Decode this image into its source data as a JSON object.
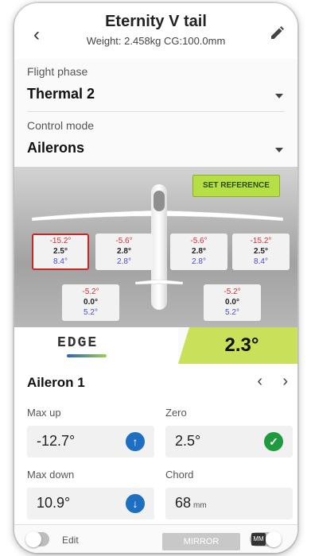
{
  "header": {
    "title": "Eternity V tail",
    "subtitle": "Weight: 2.458kg  CG:100.0mm",
    "back_icon": "chevron-left",
    "edit_icon": "pencil"
  },
  "flight_phase": {
    "label": "Flight phase",
    "value": "Thermal 2"
  },
  "control_mode": {
    "label": "Control mode",
    "value": "Ailerons"
  },
  "set_reference_label": "SET REFERENCE",
  "surfaces": [
    {
      "name": "left-aileron",
      "up": "-15.2°",
      "zero": "2.5°",
      "down": "8.4°",
      "selected": true
    },
    {
      "name": "left-flap",
      "up": "-5.6°",
      "zero": "2.8°",
      "down": "2.8°",
      "selected": false
    },
    {
      "name": "right-flap",
      "up": "-5.6°",
      "zero": "2.8°",
      "down": "2.8°",
      "selected": false
    },
    {
      "name": "right-aileron",
      "up": "-15.2°",
      "zero": "2.5°",
      "down": "8.4°",
      "selected": false
    },
    {
      "name": "left-tail",
      "up": "-5.2°",
      "zero": "0.0°",
      "down": "5.2°",
      "selected": false
    },
    {
      "name": "right-tail",
      "up": "-5.2°",
      "zero": "0.0°",
      "down": "5.2°",
      "selected": false
    }
  ],
  "logo_text": "EDGE",
  "current_angle": "2.3°",
  "surface_name": "Aileron 1",
  "max_up": {
    "label": "Max up",
    "value": "-12.7°",
    "icon": "arrow-up"
  },
  "zero": {
    "label": "Zero",
    "value": "2.5°",
    "icon": "checkmark"
  },
  "max_down": {
    "label": "Max down",
    "value": "10.9°",
    "icon": "arrow-down"
  },
  "chord": {
    "label": "Chord",
    "value": "68",
    "unit": "mm"
  },
  "footer": {
    "edit_label": "Edit",
    "mirror_label": "MIRROR",
    "mm_label": "MM"
  },
  "colors": {
    "accent_green": "#c8e05a",
    "set_reference_green": "#b5df44",
    "up_red": "#d32f2f",
    "down_blue": "#4a4ad8",
    "button_blue": "#1e6fc2",
    "check_green": "#1f9a3f"
  }
}
